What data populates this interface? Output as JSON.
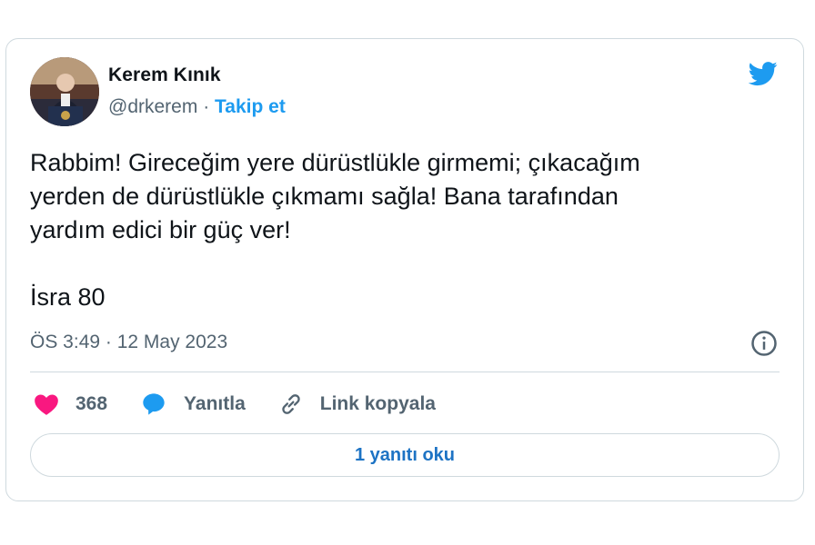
{
  "author": {
    "name": "Kerem Kınık",
    "handle": "@drkerem",
    "separator": "·",
    "follow_label": "Takip et"
  },
  "tweet": {
    "text": "Rabbim! Gireceğim yere dürüstlükle girmemi; çıkacağım\nyerden de dürüstlükle çıkmamı sağla! Bana tarafından\nyardım edici bir güç ver!\n\nİsra 80",
    "timestamp": "ÖS 3:49 · 12 May 2023"
  },
  "actions": {
    "like_count": "368",
    "reply_label": "Yanıtla",
    "copy_link_label": "Link kopyala"
  },
  "read_replies_label": "1 yanıtı oku",
  "icons": {
    "brand": "twitter-bird-icon",
    "info": "info-icon",
    "like": "heart-icon",
    "reply": "speech-bubble-icon",
    "link": "link-icon"
  },
  "colors": {
    "accent": "#1d9bf0",
    "like": "#f91880",
    "muted": "#536471",
    "text": "#0f1419"
  }
}
